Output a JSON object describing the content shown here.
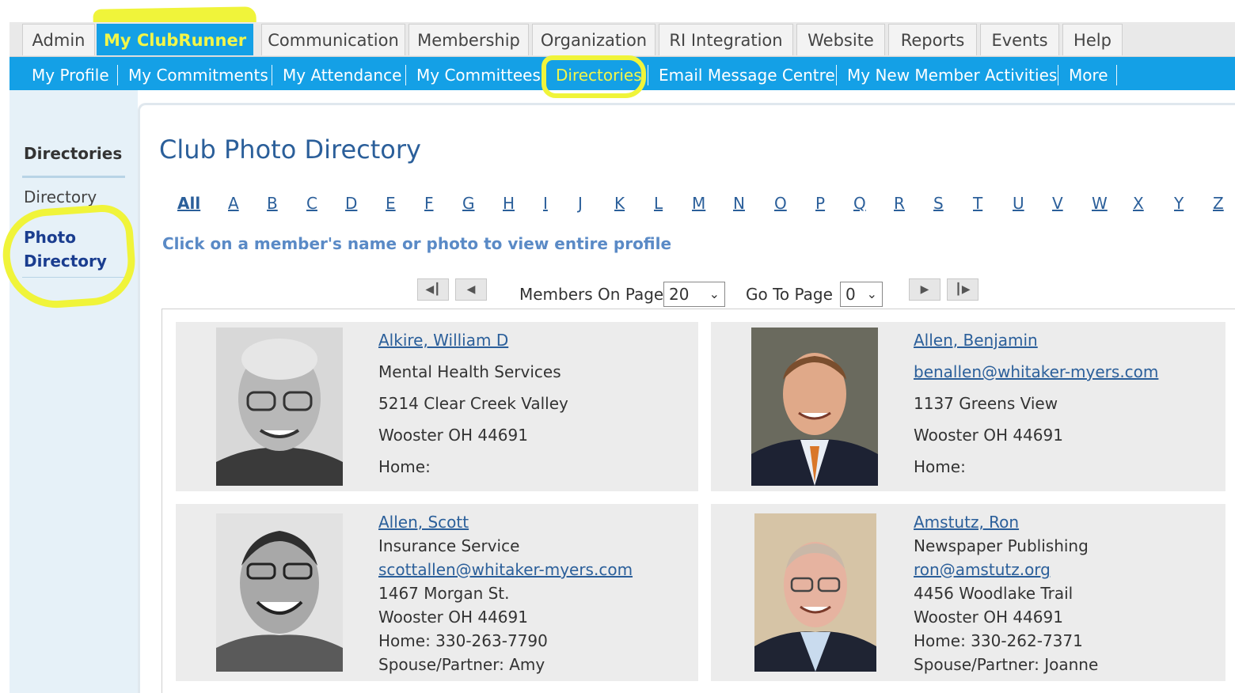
{
  "top_tabs": [
    "Admin",
    "My ClubRunner",
    "Communication",
    "Membership",
    "Organization",
    "RI Integration",
    "Website",
    "Reports",
    "Events",
    "Help"
  ],
  "sub_nav": [
    "My Profile",
    "My Commitments",
    "My Attendance",
    "My Committees",
    "Directories",
    "Email Message Centre",
    "My New Member Activities",
    "More"
  ],
  "sidebar": {
    "title": "Directories",
    "items": [
      "Directory",
      "Photo Directory"
    ]
  },
  "page_title": "Club Photo Directory",
  "alphabet": [
    "All",
    "A",
    "B",
    "C",
    "D",
    "E",
    "F",
    "G",
    "H",
    "I",
    "J",
    "K",
    "L",
    "M",
    "N",
    "O",
    "P",
    "Q",
    "R",
    "S",
    "T",
    "U",
    "V",
    "W",
    "X",
    "Y",
    "Z"
  ],
  "instruction": "Click on a member's name or photo to view entire profile",
  "pager": {
    "members_label": "Members On Page",
    "members_value": "20",
    "goto_label": "Go To Page",
    "goto_value": "0",
    "first_icon": "first-page-icon",
    "prev_icon": "prev-page-icon",
    "next_icon": "next-page-icon",
    "last_icon": "last-page-icon"
  },
  "members": [
    {
      "name": "Alkire, William D",
      "lines": [
        "Mental Health Services",
        "5214 Clear Creek Valley",
        "Wooster OH 44691",
        "Home:"
      ],
      "email": "",
      "photo_style": "bw"
    },
    {
      "name": "Allen, Benjamin",
      "email": "benallen@whitaker-myers.com",
      "lines": [
        "1137 Greens View",
        "Wooster OH 44691",
        "Home:"
      ],
      "photo_style": "color"
    },
    {
      "name": "Allen, Scott",
      "lines": [
        "Insurance Service"
      ],
      "email": "scottallen@whitaker-myers.com",
      "lines2": [
        "1467 Morgan St.",
        "Wooster OH 44691",
        "Home: 330-263-7790",
        "Spouse/Partner: Amy"
      ],
      "photo_style": "bw"
    },
    {
      "name": "Amstutz, Ron",
      "lines": [
        "Newspaper Publishing"
      ],
      "email": "ron@amstutz.org",
      "lines2": [
        "4456 Woodlake Trail",
        "Wooster OH 44691",
        "Home: 330-262-7371",
        "Spouse/Partner: Joanne"
      ],
      "photo_style": "color"
    }
  ],
  "colors": {
    "nav_blue": "#14a0e6",
    "highlight_yellow": "#f0f43a",
    "link_blue": "#2b5f9a"
  }
}
